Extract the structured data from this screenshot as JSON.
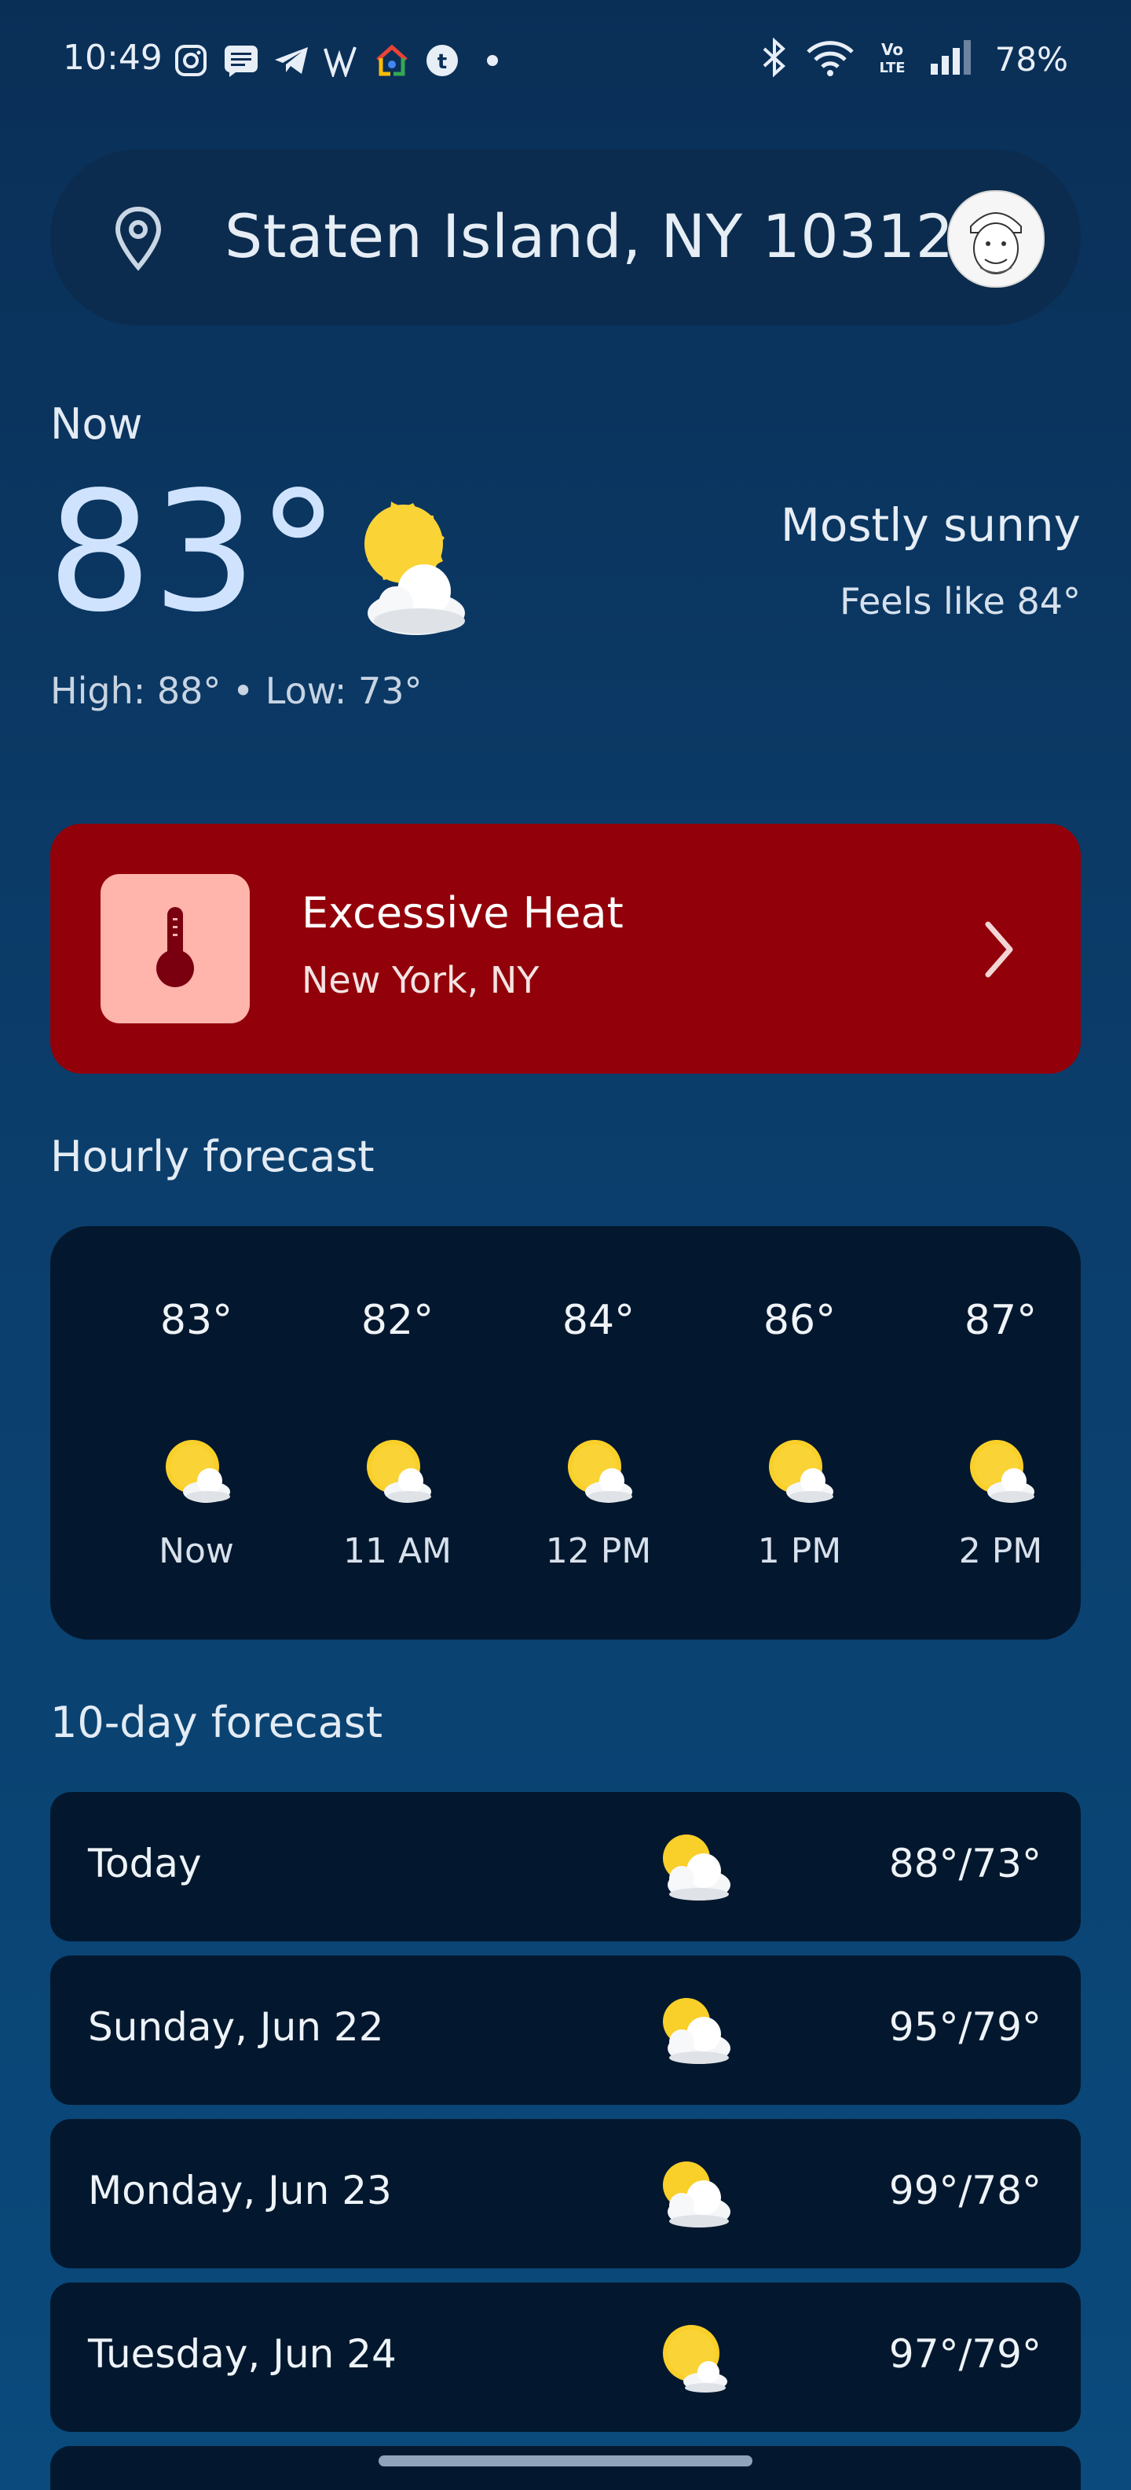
{
  "status_bar": {
    "time": "10:49",
    "battery": "78%",
    "left_icons": [
      "instagram-icon",
      "messages-icon",
      "telegram-icon",
      "w-app-icon",
      "google-home-icon",
      "tumblr-icon",
      "dot-icon"
    ],
    "right_icons": [
      "bluetooth-icon",
      "wifi-icon",
      "volte-icon",
      "signal-icon"
    ],
    "volte_label": "Vo LTE"
  },
  "location": {
    "text": "Staten Island, NY 10312",
    "pin_icon": "location-pin-icon",
    "avatar_icon": "profile-avatar"
  },
  "current": {
    "label": "Now",
    "temperature": "83°",
    "condition": "Mostly sunny",
    "feels_like": "Feels like 84°",
    "high_low": "High: 88° • Low: 73°",
    "icon": "mostly-sunny-icon"
  },
  "alert": {
    "title": "Excessive Heat",
    "location": "New York, NY",
    "icon": "thermometer-icon",
    "chevron": "chevron-right-icon",
    "background": "#920009",
    "icon_background": "#ffb4ac"
  },
  "hourly": {
    "title": "Hourly forecast",
    "items": [
      {
        "temp": "83°",
        "time": "Now",
        "icon": "mostly-sunny-icon"
      },
      {
        "temp": "82°",
        "time": "11 AM",
        "icon": "mostly-sunny-icon"
      },
      {
        "temp": "84°",
        "time": "12 PM",
        "icon": "mostly-sunny-icon"
      },
      {
        "temp": "86°",
        "time": "1 PM",
        "icon": "mostly-sunny-icon"
      },
      {
        "temp": "87°",
        "time": "2 PM",
        "icon": "mostly-sunny-icon"
      }
    ]
  },
  "daily": {
    "title": "10-day forecast",
    "items": [
      {
        "day": "Today",
        "temps": "88°/73°",
        "icon": "partly-cloudy-icon"
      },
      {
        "day": "Sunday, Jun 22",
        "temps": "95°/79°",
        "icon": "partly-cloudy-icon"
      },
      {
        "day": "Monday, Jun 23",
        "temps": "99°/78°",
        "icon": "partly-cloudy-icon"
      },
      {
        "day": "Tuesday, Jun 24",
        "temps": "97°/79°",
        "icon": "mostly-sunny-icon"
      }
    ]
  },
  "colors": {
    "background": "#0b3c69",
    "card": "#03182e",
    "sun": "#f9cf2a"
  }
}
